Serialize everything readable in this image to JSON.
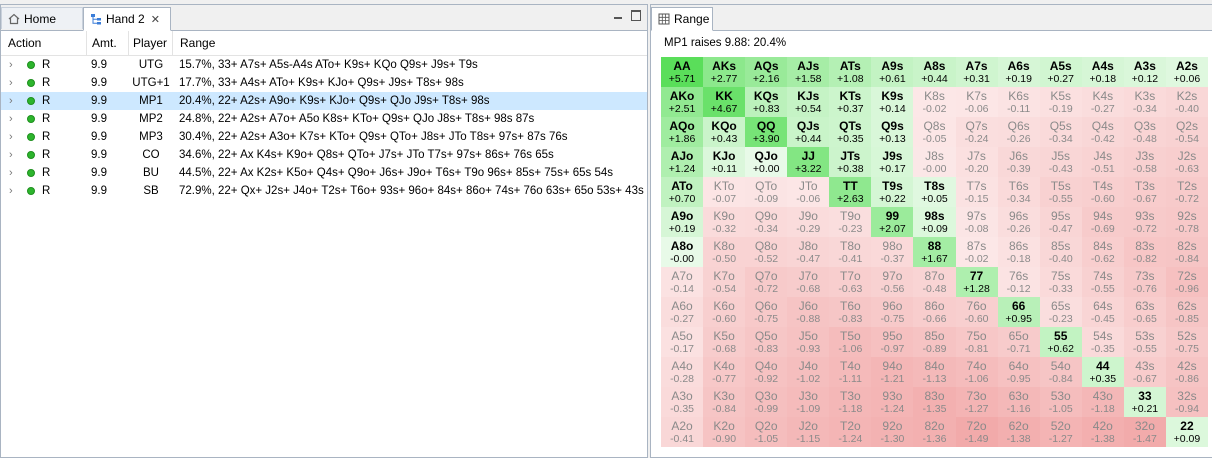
{
  "tabs": {
    "home": "Home",
    "hand": "Hand 2",
    "range": "Range"
  },
  "table": {
    "headers": {
      "action": "Action",
      "amount": "Amt.",
      "player": "Player",
      "range": "Range"
    },
    "rows": [
      {
        "action": "R",
        "amount": "9.9",
        "player": "UTG",
        "range": "15.7%, 33+ A7s+ A5s-A4s ATo+ K9s+ KQo Q9s+ J9s+ T9s"
      },
      {
        "action": "R",
        "amount": "9.9",
        "player": "UTG+1",
        "range": "17.7%, 33+ A4s+ ATo+ K9s+ KJo+ Q9s+ J9s+ T8s+ 98s"
      },
      {
        "action": "R",
        "amount": "9.9",
        "player": "MP1",
        "range": "20.4%, 22+ A2s+ A9o+ K9s+ KJo+ Q9s+ QJo J9s+ T8s+ 98s"
      },
      {
        "action": "R",
        "amount": "9.9",
        "player": "MP2",
        "range": "24.8%, 22+ A2s+ A7o+ A5o K8s+ KTo+ Q9s+ QJo J8s+ T8s+ 98s 87s"
      },
      {
        "action": "R",
        "amount": "9.9",
        "player": "MP3",
        "range": "30.4%, 22+ A2s+ A3o+ K7s+ KTo+ Q9s+ QTo+ J8s+ JTo T8s+ 97s+ 87s 76s"
      },
      {
        "action": "R",
        "amount": "9.9",
        "player": "CO",
        "range": "34.6%, 22+ Ax K4s+ K9o+ Q8s+ QTo+ J7s+ JTo T7s+ 97s+ 86s+ 76s 65s"
      },
      {
        "action": "R",
        "amount": "9.9",
        "player": "BU",
        "range": "44.5%, 22+ Ax K2s+ K5o+ Q4s+ Q9o+ J6s+ J9o+ T6s+ T9o 96s+ 85s+ 75s+ 65s 54s"
      },
      {
        "action": "R",
        "amount": "9.9",
        "player": "SB",
        "range": "72.9%, 22+ Qx+ J2s+ J4o+ T2s+ T6o+ 93s+ 96o+ 84s+ 86o+ 74s+ 76o 63s+ 65o 53s+ 43s"
      }
    ],
    "selected_index": 2
  },
  "range_panel": {
    "title": "MP1 raises 9.88: 20.4%",
    "ranks": [
      "A",
      "K",
      "Q",
      "J",
      "T",
      "9",
      "8",
      "7",
      "6",
      "5",
      "4",
      "3",
      "2"
    ],
    "values": [
      [
        "+5.71",
        "+2.77",
        "+2.16",
        "+1.58",
        "+1.08",
        "+0.61",
        "+0.44",
        "+0.31",
        "+0.19",
        "+0.27",
        "+0.18",
        "+0.12",
        "+0.06"
      ],
      [
        "+2.51",
        "+4.67",
        "+0.83",
        "+0.54",
        "+0.37",
        "+0.14",
        "-0.02",
        "-0.06",
        "-0.11",
        "-0.19",
        "-0.27",
        "-0.34",
        "-0.40"
      ],
      [
        "+1.86",
        "+0.43",
        "+3.90",
        "+0.44",
        "+0.35",
        "+0.13",
        "-0.05",
        "-0.24",
        "-0.26",
        "-0.34",
        "-0.42",
        "-0.48",
        "-0.54"
      ],
      [
        "+1.24",
        "+0.11",
        "+0.00",
        "+3.22",
        "+0.38",
        "+0.17",
        "-0.00",
        "-0.20",
        "-0.39",
        "-0.43",
        "-0.51",
        "-0.58",
        "-0.63"
      ],
      [
        "+0.70",
        "-0.07",
        "-0.09",
        "-0.06",
        "+2.63",
        "+0.22",
        "+0.05",
        "-0.15",
        "-0.34",
        "-0.55",
        "-0.60",
        "-0.67",
        "-0.72"
      ],
      [
        "+0.19",
        "-0.32",
        "-0.34",
        "-0.29",
        "-0.23",
        "+2.07",
        "+0.09",
        "-0.08",
        "-0.26",
        "-0.47",
        "-0.69",
        "-0.72",
        "-0.78"
      ],
      [
        "-0.00",
        "-0.50",
        "-0.52",
        "-0.47",
        "-0.41",
        "-0.37",
        "+1.67",
        "-0.02",
        "-0.18",
        "-0.40",
        "-0.62",
        "-0.82",
        "-0.84"
      ],
      [
        "-0.14",
        "-0.54",
        "-0.72",
        "-0.68",
        "-0.63",
        "-0.56",
        "-0.48",
        "+1.28",
        "-0.12",
        "-0.33",
        "-0.55",
        "-0.76",
        "-0.96"
      ],
      [
        "-0.27",
        "-0.60",
        "-0.75",
        "-0.88",
        "-0.83",
        "-0.75",
        "-0.66",
        "-0.60",
        "+0.95",
        "-0.23",
        "-0.45",
        "-0.65",
        "-0.85"
      ],
      [
        "-0.17",
        "-0.68",
        "-0.83",
        "-0.93",
        "-1.06",
        "-0.97",
        "-0.89",
        "-0.81",
        "-0.71",
        "+0.62",
        "-0.35",
        "-0.55",
        "-0.75"
      ],
      [
        "-0.28",
        "-0.77",
        "-0.92",
        "-1.02",
        "-1.11",
        "-1.21",
        "-1.13",
        "-1.06",
        "-0.95",
        "-0.84",
        "+0.35",
        "-0.67",
        "-0.86"
      ],
      [
        "-0.35",
        "-0.84",
        "-0.99",
        "-1.09",
        "-1.18",
        "-1.24",
        "-1.35",
        "-1.27",
        "-1.16",
        "-1.05",
        "-1.18",
        "+0.21",
        "-0.94"
      ],
      [
        "-0.41",
        "-0.90",
        "-1.05",
        "-1.15",
        "-1.24",
        "-1.30",
        "-1.36",
        "-1.49",
        "-1.38",
        "-1.27",
        "-1.38",
        "-1.47",
        "+0.09"
      ]
    ],
    "included": [
      [
        1,
        1,
        1,
        1,
        1,
        1,
        1,
        1,
        1,
        1,
        1,
        1,
        1
      ],
      [
        1,
        1,
        1,
        1,
        1,
        1,
        0,
        0,
        0,
        0,
        0,
        0,
        0
      ],
      [
        1,
        1,
        1,
        1,
        1,
        1,
        0,
        0,
        0,
        0,
        0,
        0,
        0
      ],
      [
        1,
        1,
        1,
        1,
        1,
        1,
        0,
        0,
        0,
        0,
        0,
        0,
        0
      ],
      [
        1,
        0,
        0,
        0,
        1,
        1,
        1,
        0,
        0,
        0,
        0,
        0,
        0
      ],
      [
        1,
        0,
        0,
        0,
        0,
        1,
        1,
        0,
        0,
        0,
        0,
        0,
        0
      ],
      [
        1,
        0,
        0,
        0,
        0,
        0,
        1,
        0,
        0,
        0,
        0,
        0,
        0
      ],
      [
        0,
        0,
        0,
        0,
        0,
        0,
        0,
        1,
        0,
        0,
        0,
        0,
        0
      ],
      [
        0,
        0,
        0,
        0,
        0,
        0,
        0,
        0,
        1,
        0,
        0,
        0,
        0
      ],
      [
        0,
        0,
        0,
        0,
        0,
        0,
        0,
        0,
        0,
        1,
        0,
        0,
        0
      ],
      [
        0,
        0,
        0,
        0,
        0,
        0,
        0,
        0,
        0,
        0,
        1,
        0,
        0
      ],
      [
        0,
        0,
        0,
        0,
        0,
        0,
        0,
        0,
        0,
        0,
        0,
        1,
        0
      ],
      [
        0,
        0,
        0,
        0,
        0,
        0,
        0,
        0,
        0,
        0,
        0,
        0,
        1
      ]
    ]
  }
}
